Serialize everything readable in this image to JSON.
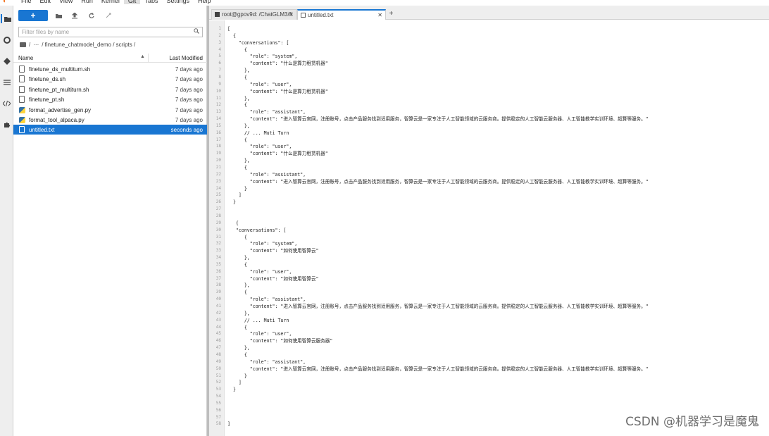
{
  "menu": {
    "items": [
      "File",
      "Edit",
      "View",
      "Run",
      "Kernel",
      "Git",
      "Tabs",
      "Settings",
      "Help"
    ],
    "active": "Git"
  },
  "activity_icons": [
    "folder-icon",
    "running-icon",
    "git-icon",
    "table-of-contents-icon",
    "code-icon",
    "extension-icon"
  ],
  "file_browser": {
    "new_label": "+",
    "filter_placeholder": "Filter files by name",
    "breadcrumb_root": "/",
    "breadcrumb_ellipsis": "···",
    "breadcrumb_path": "/ finetune_chatmodel_demo / scripts /",
    "column_name": "Name",
    "column_modified": "Last Modified",
    "files": [
      {
        "name": "finetune_ds_multiturn.sh",
        "modified": "7 days ago",
        "type": "file"
      },
      {
        "name": "finetune_ds.sh",
        "modified": "7 days ago",
        "type": "file"
      },
      {
        "name": "finetune_pt_multiturn.sh",
        "modified": "7 days ago",
        "type": "file"
      },
      {
        "name": "finetune_pt.sh",
        "modified": "7 days ago",
        "type": "file"
      },
      {
        "name": "format_advertise_gen.py",
        "modified": "7 days ago",
        "type": "python"
      },
      {
        "name": "format_tool_alpaca.py",
        "modified": "7 days ago",
        "type": "python"
      },
      {
        "name": "untitled.txt",
        "modified": "seconds ago",
        "type": "file",
        "selected": true
      }
    ]
  },
  "tabs": [
    {
      "label": "root@gpov9d: /ChatGLM3/fi",
      "active": false
    },
    {
      "label": "untitled.txt",
      "active": true
    }
  ],
  "add_tab_label": "+",
  "editor": {
    "lines": [
      "[",
      "  {",
      "    \"conversations\": [",
      "      {",
      "        \"role\": \"system\",",
      "        \"content\": \"什么是算力租赁机器\"",
      "      },",
      "      {",
      "        \"role\": \"user\",",
      "        \"content\": \"什么是算力租赁机器\"",
      "      },",
      "      {",
      "        \"role\": \"assistant\",",
      "        \"content\": \"进入智算云官网，注册账号，点击产品服务找到适用服务，智算云是一家专注于人工智能领域的云服务商。提供稳定的人工智能云服务器、人工智能教学实训环境、超算等服务。\"",
      "      },",
      "      // ... Muti Turn",
      "      {",
      "        \"role\": \"user\",",
      "        \"content\": \"什么是算力租赁机器\"",
      "      },",
      "      {",
      "        \"role\": \"assistant\",",
      "        \"content\": \"进入智算云官网，注册账号，点击产品服务找到适用服务，智算云是一家专注于人工智能领域的云服务商。提供稳定的人工智能云服务器、人工智能教学实训环境、超算等服务。\"",
      "      }",
      "    ]",
      "  }",
      "",
      "",
      "   {",
      "   \"conversations\": [",
      "      {",
      "        \"role\": \"system\",",
      "        \"content\": \"如何使用智算云\"",
      "      },",
      "      {",
      "        \"role\": \"user\",",
      "        \"content\": \"如何使用智算云\"",
      "      },",
      "      {",
      "        \"role\": \"assistant\",",
      "        \"content\": \"进入智算云官网，注册账号，点击产品服务找到适用服务，智算云是一家专注于人工智能领域的云服务商。提供稳定的人工智能云服务器、人工智能教学实训环境、超算等服务。\"",
      "      },",
      "      // ... Muti Turn",
      "      {",
      "        \"role\": \"user\",",
      "        \"content\": \"如何使用智算云服务器\"",
      "      },",
      "      {",
      "        \"role\": \"assistant\",",
      "        \"content\": \"进入智算云官网，注册账号，点击产品服务找到适用服务，智算云是一家专注于人工智能领域的云服务商。提供稳定的人工智能云服务器、人工智能教学实训环境、超算等服务。\"",
      "      }",
      "    ]",
      "  }",
      "",
      "",
      "",
      "",
      "]"
    ]
  },
  "watermark": "CSDN @机器学习是魔鬼",
  "colors": {
    "accent": "#1976d2",
    "logo": "#f37726"
  }
}
